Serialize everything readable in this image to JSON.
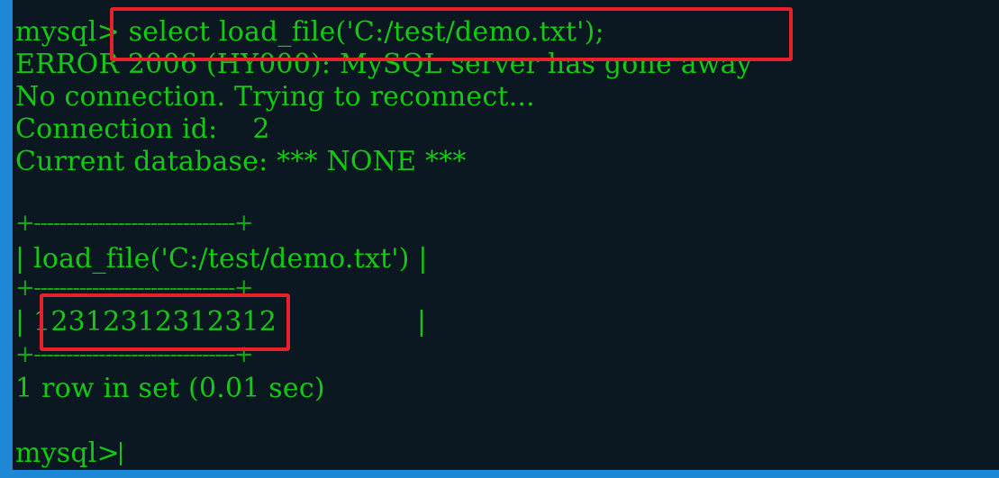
{
  "terminal": {
    "lines": {
      "cmd_prompt": "mysql>",
      "cmd_text": " select load_file('C:/test/demo.txt');",
      "error": "ERROR 2006 (HY000): MySQL server has gone away",
      "no_conn": "No connection. Trying to reconnect...",
      "conn_id": "Connection id:    2",
      "cur_db": "Current database: *** NONE ***",
      "border_top": "+-------------------------------+",
      "header_row": "| load_file('C:/test/demo.txt') |",
      "border_mid": "+-------------------------------+",
      "value_left": "| ",
      "value_text": "12312312312312",
      "value_right": "                |",
      "border_bot": "+-------------------------------+",
      "row_count": "1 row in set (0.01 sec)",
      "final_prompt": "mysql>"
    },
    "colors": {
      "text": "#13c913",
      "background": "#0c1821",
      "highlight": "#e8202a",
      "frame": "#1e88d6"
    }
  }
}
